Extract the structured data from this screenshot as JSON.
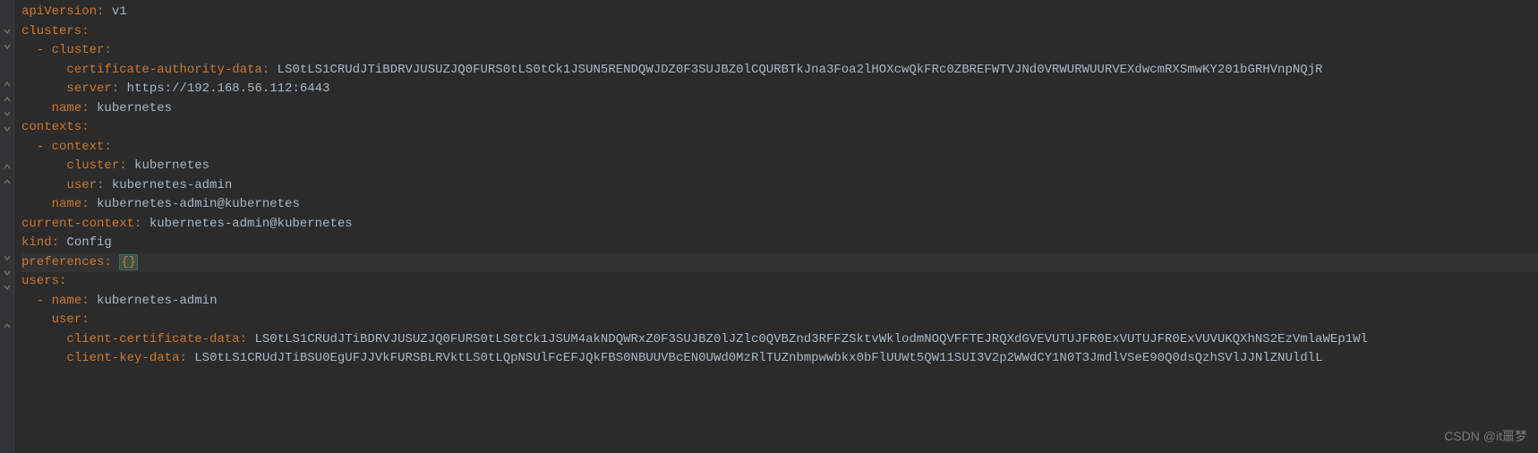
{
  "lines": [
    {
      "indent": 0,
      "key": "apiVersion",
      "value": "v1"
    },
    {
      "indent": 0,
      "key": "clusters",
      "value": ""
    },
    {
      "indent": 1,
      "dash": true,
      "key": "cluster",
      "value": ""
    },
    {
      "indent": 3,
      "key": "certificate-authority-data",
      "value": "LS0tLS1CRUdJTiBDRVJUSUZJQ0FURS0tLS0tCk1JSUN5RENDQWJDZ0F3SUJBZ0lCQURBTkJna3Foa2lHOXcwQkFRc0ZBREFWTVJNd0VRWURWUURVEXdwcmRXSmwKY201bGRHVnpNQjR"
    },
    {
      "indent": 3,
      "key": "server",
      "value": "https://192.168.56.112:6443"
    },
    {
      "indent": 2,
      "key": "name",
      "value": "kubernetes"
    },
    {
      "indent": 0,
      "key": "contexts",
      "value": ""
    },
    {
      "indent": 1,
      "dash": true,
      "key": "context",
      "value": ""
    },
    {
      "indent": 3,
      "key": "cluster",
      "value": "kubernetes"
    },
    {
      "indent": 3,
      "key": "user",
      "value": "kubernetes-admin"
    },
    {
      "indent": 2,
      "key": "name",
      "value": "kubernetes-admin@kubernetes"
    },
    {
      "indent": 0,
      "key": "current-context",
      "value": "kubernetes-admin@kubernetes"
    },
    {
      "indent": 0,
      "key": "kind",
      "value": "Config"
    },
    {
      "indent": 0,
      "key": "preferences",
      "value": "",
      "braces": true,
      "highlighted": true
    },
    {
      "indent": 0,
      "key": "users",
      "value": ""
    },
    {
      "indent": 1,
      "dash": true,
      "key": "name",
      "value": "kubernetes-admin"
    },
    {
      "indent": 2,
      "key": "user",
      "value": ""
    },
    {
      "indent": 3,
      "key": "client-certificate-data",
      "value": "LS0tLS1CRUdJTiBDRVJUSUZJQ0FURS0tLS0tCk1JSUM4akNDQWRxZ0F3SUJBZ0lJZlc0QVBZnd3RFFZSktvWklodmNOQVFFTEJRQXdGVEVUTUJFR0ExVUTUJFR0ExVUVUKQXhNS2EzVmlaWEp1Wl"
    },
    {
      "indent": 3,
      "key": "client-key-data",
      "value": "LS0tLS1CRUdJTiBSU0EgUFJJVkFURSBLRVktLS0tLQpNSUlFcEFJQkFBS0NBUUVBcEN0UWd0MzRlTUZnbmpwwbkx0bFlUUWt5QW11SUI3V2p2WWdCY1N0T3JmdlVSeE90Q0dsQzhSVlJJNlZNUldlL"
    }
  ],
  "foldMarkers": [
    {
      "type": "none"
    },
    {
      "type": "open"
    },
    {
      "type": "open"
    },
    {
      "type": "none"
    },
    {
      "type": "close"
    },
    {
      "type": "close"
    },
    {
      "type": "open"
    },
    {
      "type": "open"
    },
    {
      "type": "none"
    },
    {
      "type": "close"
    },
    {
      "type": "close"
    },
    {
      "type": "none"
    },
    {
      "type": "none"
    },
    {
      "type": "none"
    },
    {
      "type": "open"
    },
    {
      "type": "open"
    },
    {
      "type": "open"
    },
    {
      "type": "none"
    },
    {
      "type": "close"
    }
  ],
  "watermark": "CSDN @it噩梦"
}
